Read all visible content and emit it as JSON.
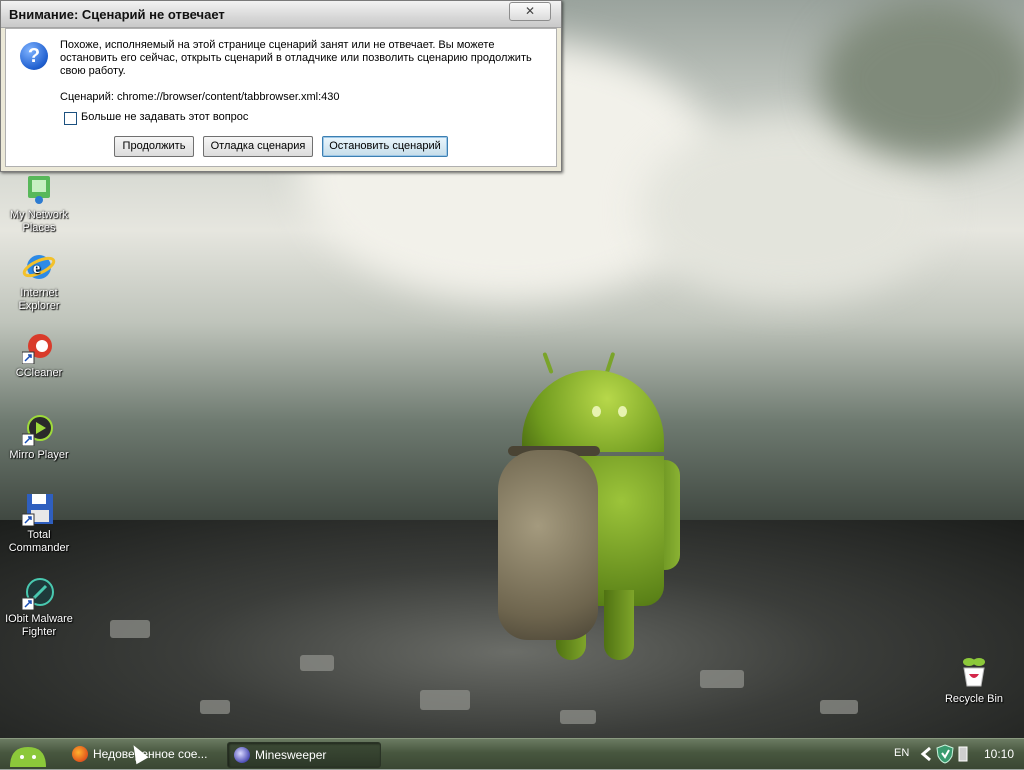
{
  "dialog": {
    "title": "Внимание: Сценарий не отвечает",
    "close_label": "✕",
    "message": "Похоже, исполняемый на этой странице сценарий занят или не отвечает. Вы можете остановить его сейчас, открыть сценарий в отладчике или позволить сценарию продолжить свою работу.",
    "script_line": "Сценарий: chrome://browser/content/tabbrowser.xml:430",
    "checkbox_label": "Больше не задавать этот вопрос",
    "checkbox_checked": false,
    "buttons": {
      "continue": "Продолжить",
      "debug": "Отладка сценария",
      "stop": "Остановить сценарий"
    }
  },
  "desktop_icons": [
    {
      "label": "My Network Places",
      "icon": "network-places-icon"
    },
    {
      "label": "Internet Explorer",
      "icon": "internet-explorer-icon"
    },
    {
      "label": "CCleaner",
      "icon": "ccleaner-icon"
    },
    {
      "label": "Mirro Player",
      "icon": "mirro-player-icon"
    },
    {
      "label": "Total Commander",
      "icon": "total-commander-icon"
    },
    {
      "label": "IObit Malware Fighter",
      "icon": "iobit-malware-fighter-icon"
    },
    {
      "label": "Recycle Bin",
      "icon": "recycle-bin-icon"
    }
  ],
  "taskbar": {
    "tasks": [
      {
        "label": "Недоверенное сое...",
        "icon": "firefox-icon"
      },
      {
        "label": "Minesweeper",
        "icon": "minesweeper-icon"
      }
    ],
    "language": "EN",
    "clock": "10:10"
  },
  "colors": {
    "dialog_bg": "#ece9d8",
    "taskbar": "#48573f",
    "android_green": "#8ab233"
  }
}
